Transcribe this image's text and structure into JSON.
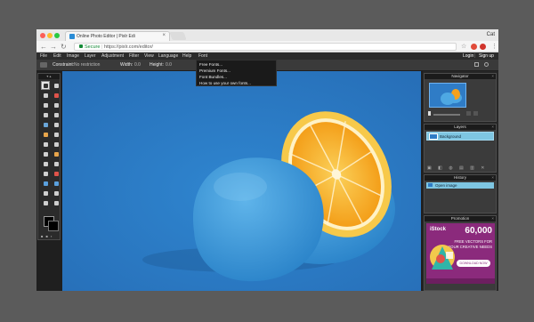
{
  "browser": {
    "tab_title": "Online Photo Editor | Pixlr Edi",
    "tab_close": "×",
    "user": "Cat",
    "url_secure": "Secure",
    "url": "https://pixlr.com/editor/",
    "back": "←",
    "forward": "→",
    "reload": "↻",
    "star": "☆",
    "menu": "⋮"
  },
  "menu": {
    "items": [
      "File",
      "Edit",
      "Image",
      "Layer",
      "Adjustment",
      "Filter",
      "View",
      "Language",
      "Help",
      "Font"
    ],
    "login": "Login",
    "separator": "|",
    "signup": "Sign up"
  },
  "options": {
    "constraint_label": "Constraint:",
    "constraint_value": "No restriction",
    "width_label": "Width:",
    "width_value": "0.0",
    "height_label": "Height:",
    "height_value": "0.0"
  },
  "font_dropdown": {
    "items": [
      "Free Fonts...",
      "Premium Fonts...",
      "Font Bundles...",
      "How to use your own fonts..."
    ]
  },
  "panels": {
    "navigator": {
      "title": "Navigator",
      "close": "×"
    },
    "layers": {
      "title": "Layers",
      "close": "×",
      "layer_name": "Background"
    },
    "history": {
      "title": "History",
      "close": "×",
      "item": "Open image"
    },
    "promotion": {
      "title": "Promotion",
      "close": "×",
      "brand": "iStock",
      "count": "60,000",
      "line1": "FREE VECTORS FOR",
      "line2": "YOUR CREATIVE NEEDS",
      "cta": "DOWNLOAD NOW"
    }
  },
  "colors": {
    "canvas_bg": "#2f7cc6",
    "orange_flesh": "#f5a11c",
    "orange_rind": "#f7c94a",
    "blue_peel": "#3b97d6",
    "selection_blue": "#7ec6e2",
    "ad_purple": "#8b2a7c"
  }
}
